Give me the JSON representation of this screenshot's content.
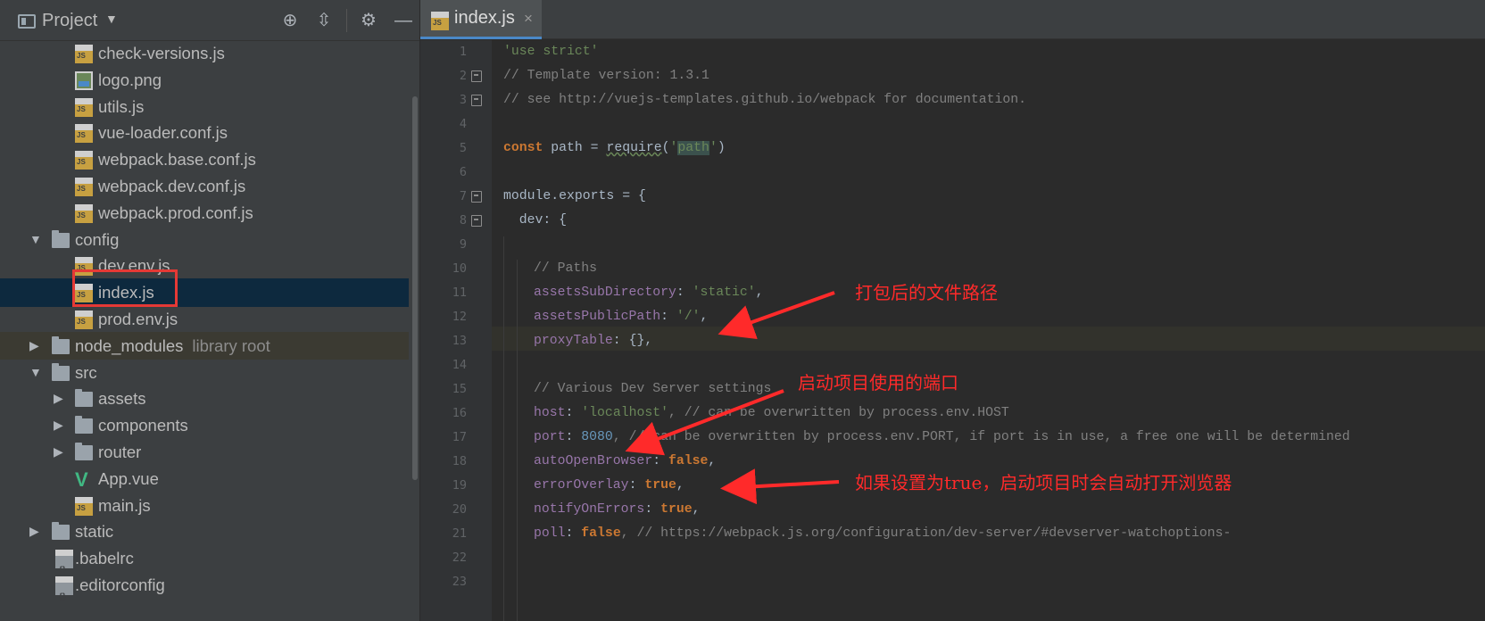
{
  "project_panel": {
    "title": "Project",
    "dropdown_icon": "caret-down-icon",
    "buttons": [
      "locate-icon",
      "collapse-all-icon",
      "gear-icon",
      "hide-icon"
    ],
    "tree": [
      {
        "label": "check-versions.js",
        "icon": "js-file-icon"
      },
      {
        "label": "logo.png",
        "icon": "image-file-icon"
      },
      {
        "label": "utils.js",
        "icon": "js-file-icon"
      },
      {
        "label": "vue-loader.conf.js",
        "icon": "js-file-icon"
      },
      {
        "label": "webpack.base.conf.js",
        "icon": "js-file-icon"
      },
      {
        "label": "webpack.dev.conf.js",
        "icon": "js-file-icon"
      },
      {
        "label": "webpack.prod.conf.js",
        "icon": "js-file-icon"
      },
      {
        "label": "config",
        "icon": "folder-icon",
        "expanded": true
      },
      {
        "label": "dev.env.js",
        "icon": "js-file-icon"
      },
      {
        "label": "index.js",
        "icon": "js-file-icon",
        "selected": true
      },
      {
        "label": "prod.env.js",
        "icon": "js-file-icon"
      },
      {
        "label": "node_modules",
        "sub": "library root",
        "icon": "folder-icon",
        "expanded": false
      },
      {
        "label": "src",
        "icon": "folder-icon",
        "expanded": true
      },
      {
        "label": "assets",
        "icon": "folder-icon",
        "expanded": false
      },
      {
        "label": "components",
        "icon": "folder-icon",
        "expanded": false
      },
      {
        "label": "router",
        "icon": "folder-icon",
        "expanded": false
      },
      {
        "label": "App.vue",
        "icon": "vue-file-icon"
      },
      {
        "label": "main.js",
        "icon": "js-file-icon"
      },
      {
        "label": "static",
        "icon": "folder-icon",
        "expanded": false
      },
      {
        "label": ".babelrc",
        "icon": "config-file-icon"
      },
      {
        "label": ".editorconfig",
        "icon": "config-file-icon"
      }
    ]
  },
  "editor": {
    "tab": {
      "label": "index.js",
      "close": "×"
    },
    "line_numbers": [
      "1",
      "2",
      "3",
      "4",
      "5",
      "6",
      "7",
      "8",
      "9",
      "10",
      "11",
      "12",
      "13",
      "14",
      "15",
      "16",
      "17",
      "18",
      "19",
      "20",
      "21",
      "22",
      "23"
    ],
    "lines": {
      "l1": "'use strict'",
      "l2": "// Template version: 1.3.1",
      "l3": "// see http://vuejs-templates.github.io/webpack for documentation.",
      "l5_kw": "const",
      "l5_a": " path = ",
      "l5_fn": "require",
      "l5_b": "(",
      "l5_q1": "'",
      "l5_str": "path",
      "l5_q2": "'",
      "l5_c": ")",
      "l7": "module.exports = {",
      "l8": "  dev: {",
      "l10": "// Paths",
      "l11_key": "assetsSubDirectory",
      "l11_val": "'static'",
      "l11_tail": ",",
      "l12_key": "assetsPublicPath",
      "l12_val": "'/'",
      "l12_tail": ",",
      "l13_key": "proxyTable",
      "l13_val": " {},",
      "l15": "// Various Dev Server settings",
      "l16_key": "host",
      "l16_val": "'localhost'",
      "l16_cmt": ", // can be overwritten by process.env.HOST",
      "l17_key": "port",
      "l17_val": "8080",
      "l17_cmt": ", // can be overwritten by process.env.PORT, if port is in use, a free one will be determined",
      "l18_key": "autoOpenBrowser",
      "l18_val": "false",
      "l19_key": "errorOverlay",
      "l19_val": "true",
      "l20_key": "notifyOnErrors",
      "l20_val": "true",
      "l21_key": "poll",
      "l21_val": "false",
      "l21_cmt": ", // https://webpack.js.org/configuration/dev-server/#devserver-watchoptions-"
    }
  },
  "annotations": {
    "a1": "打包后的文件路径",
    "a2": "启动项目使用的端口",
    "a3": "如果设置为true，启动项目时会自动打开浏览器",
    "color": "#ff2a2a"
  }
}
